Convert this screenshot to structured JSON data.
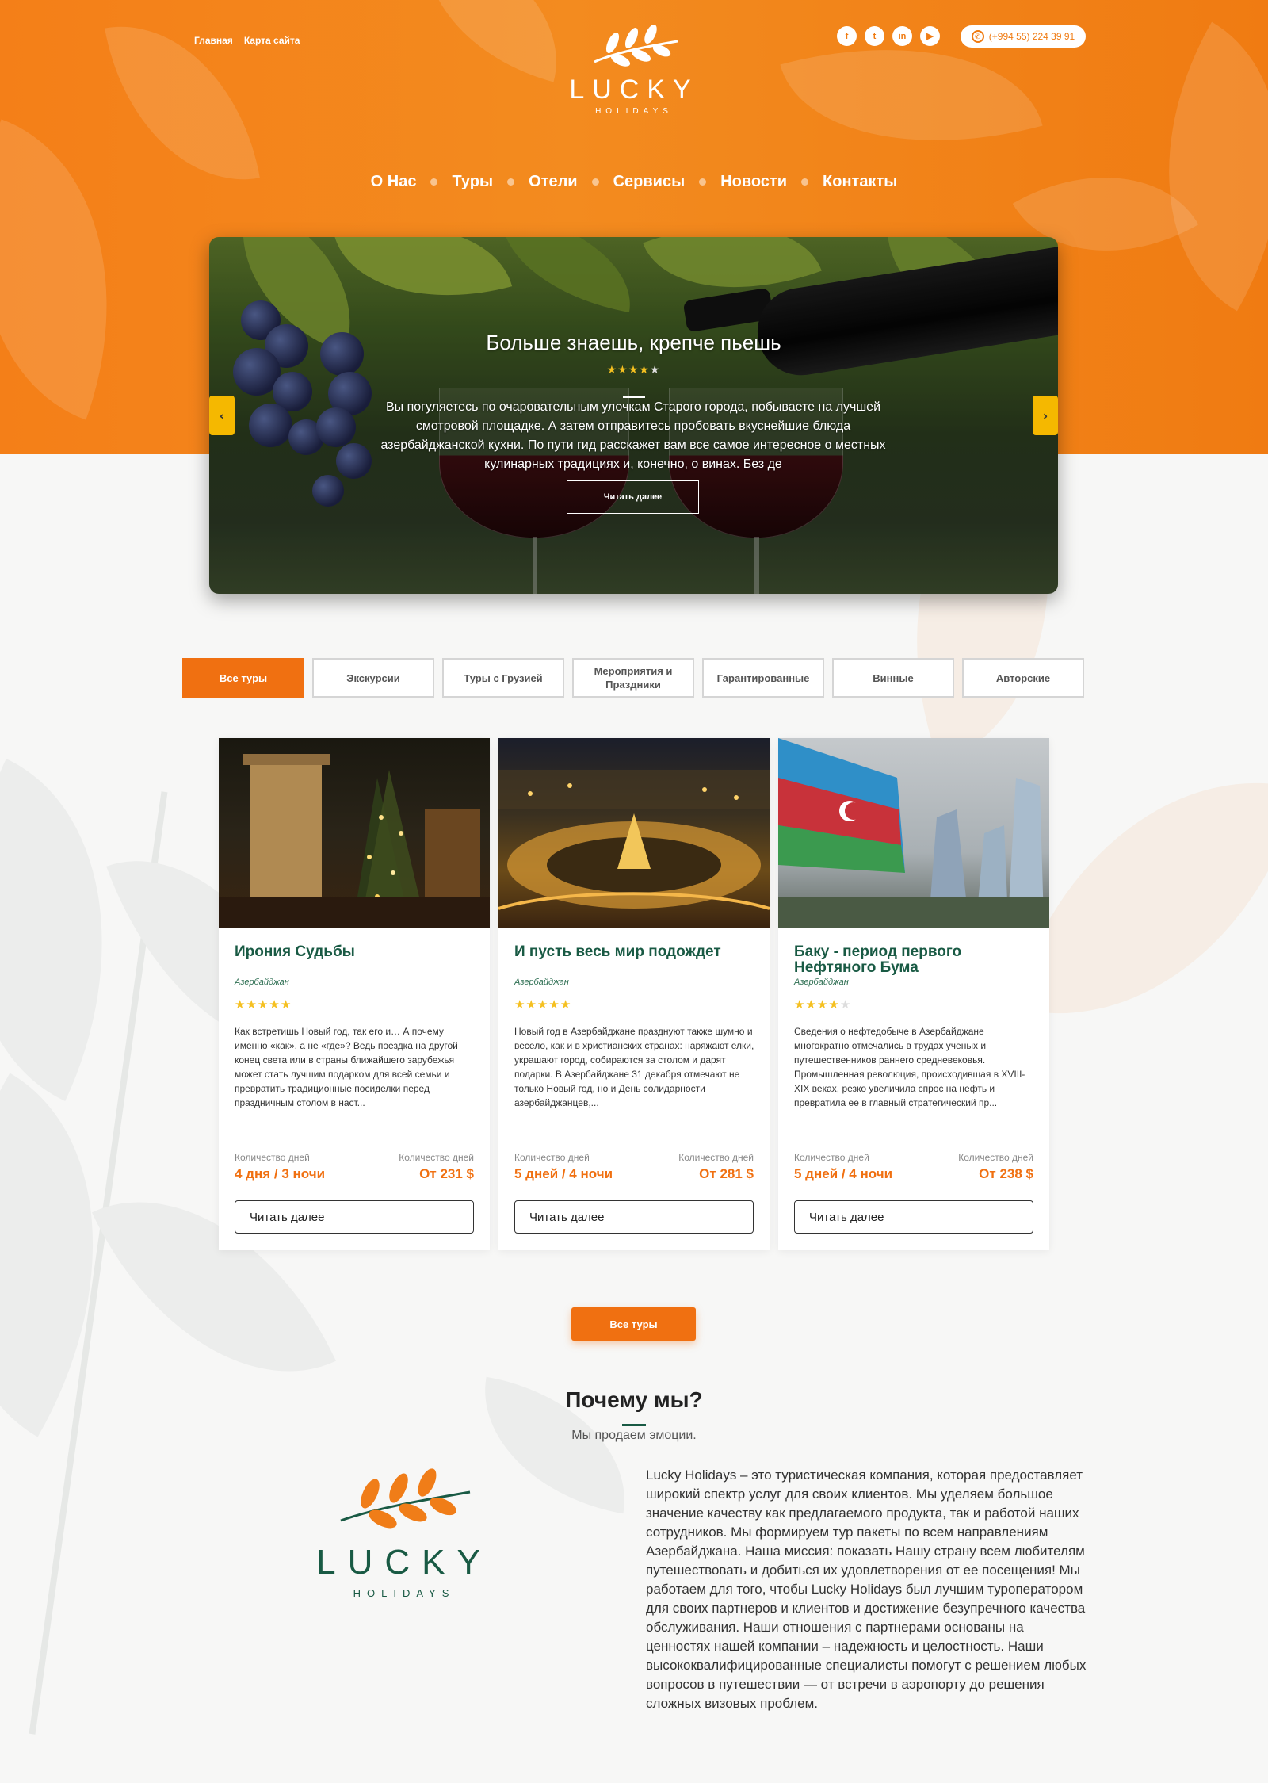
{
  "top_links": [
    "Главная",
    "Карта сайта"
  ],
  "brand": {
    "name": "LUCKY",
    "sub": "HOLIDAYS"
  },
  "social": [
    "facebook-icon",
    "twitter-icon",
    "linkedin-icon",
    "youtube-icon"
  ],
  "phone": "(+994 55) 224 39 91",
  "nav": [
    "О Нас",
    "Туры",
    "Отели",
    "Сервисы",
    "Новости",
    "Контакты"
  ],
  "hero": {
    "title": "Больше знаешь, крепче пьешь",
    "rating": 4,
    "text": "Вы погуляетесь по очаровательным улочкам Старого города, побываете на лучшей смотровой площадке. А затем отправитесь пробовать вкуснейшие блюда азербайджанской кухни. По пути гид расскажет вам все самое интересное о местных кулинарных традициях и, конечно, о винах. Без де",
    "button": "Читать далее"
  },
  "filters": [
    "Все туры",
    "Экскурсии",
    "Туры с Грузией",
    "Мероприятия и Праздники",
    "Гарантированные",
    "Винные",
    "Авторские"
  ],
  "active_filter": "Все туры",
  "cards": [
    {
      "title": "Ирония Судьбы",
      "country": "Азербайджан",
      "rating": 5,
      "text": "Как встретишь Новый год, так его и… А почему именно «как», а не «где»? Ведь поездка на другой конец света или в страны ближайшего зарубежья может стать лучшим подарком для всей семьи и превратить традиционные посиделки перед праздничным столом в наст...",
      "days_label": "Количество дней",
      "days": "4 дня / 3 ночи",
      "price_label": "Количество дней",
      "price": "От 231 $",
      "button": "Читать далее"
    },
    {
      "title": "И пусть весь мир подождет",
      "country": "Азербайджан",
      "rating": 5,
      "text": "Новый год в Азербайджане празднуют также шумно и весело, как и в христианских странах: наряжают елки, украшают город, собираются за столом и дарят подарки. В Азербайджане 31 декабря отмечают не только Новый год, но и День солидарности азербайджанцев,...",
      "days_label": "Количество дней",
      "days": "5 дней / 4 ночи",
      "price_label": "Количество дней",
      "price": "От 281 $",
      "button": "Читать далее"
    },
    {
      "title": "Баку - период первого Нефтяного Бума",
      "country": "Азербайджан",
      "rating": 4,
      "text": "Сведения о нефтедобыче в Азербайджане многократно отмечались в трудах ученых и путешественников раннего средневековья. Промышленная революция, происходившая в XVIII-XIX веках, резко увеличила спрос на нефть и превратила ее в главный стратегический пр...",
      "days_label": "Количество дней",
      "days": "5 дней / 4 ночи",
      "price_label": "Количество дней",
      "price": "От 238 $",
      "button": "Читать далее"
    }
  ],
  "all_tours_button": "Все туры",
  "why": {
    "title": "Почему мы?",
    "subtitle": "Мы продаем эмоции.",
    "text": "Lucky Holidays – это туристическая компания, которая предоставляет широкий спектр услуг для своих клиентов. Мы уделяем большое значение качеству как предлагаемого продукта, так и работой наших сотрудников. Мы формируем тур пакеты по всем направлениям Азербайджана. Наша миссия: показать Нашу страну всем любителям путешествовать и добиться их удовлетворения от ее посещения! Мы работаем для того, чтобы Lucky Holidays был лучшим туроператором для своих партнеров и клиентов и достижение безупречного качества обслуживания. Наши отношения с партнерами основаны на ценностях нашей компании – надежность и целостность. Наши высококвалифицированные специалисты помогут с решением любых вопросов в путешествии — от встречи в аэропорту до решения сложных визовых проблем."
  },
  "colors": {
    "orange": "#f07011",
    "green": "#195a44",
    "star": "#f5c020"
  }
}
